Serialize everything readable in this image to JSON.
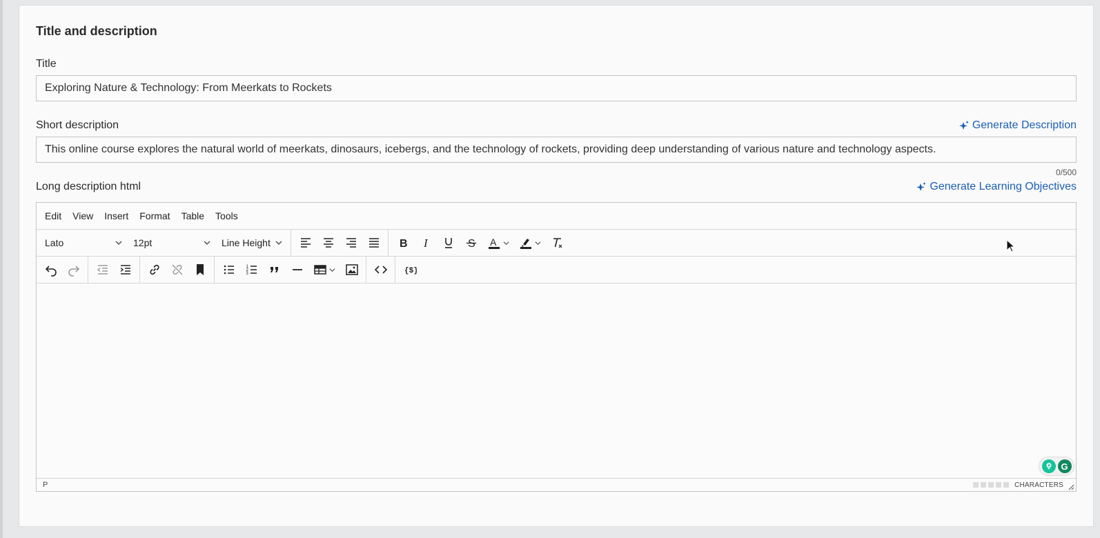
{
  "section": {
    "title": "Title and description"
  },
  "title_field": {
    "label": "Title",
    "value": "Exploring Nature & Technology: From Meerkats to Rockets"
  },
  "short_description": {
    "label": "Short description",
    "value": "This online course explores the natural world of meerkats, dinosaurs, icebergs, and the technology of rockets, providing deep understanding of various nature and technology aspects.",
    "counter": "0/500",
    "generate_label": "Generate Description"
  },
  "long_description": {
    "label": "Long description html",
    "generate_label": "Generate Learning Objectives"
  },
  "editor": {
    "menu": [
      "Edit",
      "View",
      "Insert",
      "Format",
      "Table",
      "Tools"
    ],
    "font_family": "Lato",
    "font_size": "12pt",
    "line_height": "Line Height",
    "status_path": "P",
    "status_count_label": "CHARACTERS"
  },
  "colors": {
    "accent": "#1a5fb4",
    "grammarly_green": "#15c39a",
    "grammarly_dark": "#11875f"
  },
  "icons": {
    "toolbar_row1": [
      "align-left-icon",
      "align-center-icon",
      "align-right-icon",
      "align-justify-icon",
      "bold-icon",
      "italic-icon",
      "underline-icon",
      "strikethrough-icon",
      "text-color-icon",
      "highlight-icon",
      "clear-format-icon"
    ],
    "toolbar_row2": [
      "undo-icon",
      "redo-icon",
      "outdent-icon",
      "indent-icon",
      "link-icon",
      "unlink-icon",
      "bookmark-icon",
      "bullet-list-icon",
      "numbered-list-icon",
      "blockquote-icon",
      "horizontal-rule-icon",
      "table-icon",
      "image-icon",
      "code-icon",
      "template-variable-icon"
    ]
  }
}
